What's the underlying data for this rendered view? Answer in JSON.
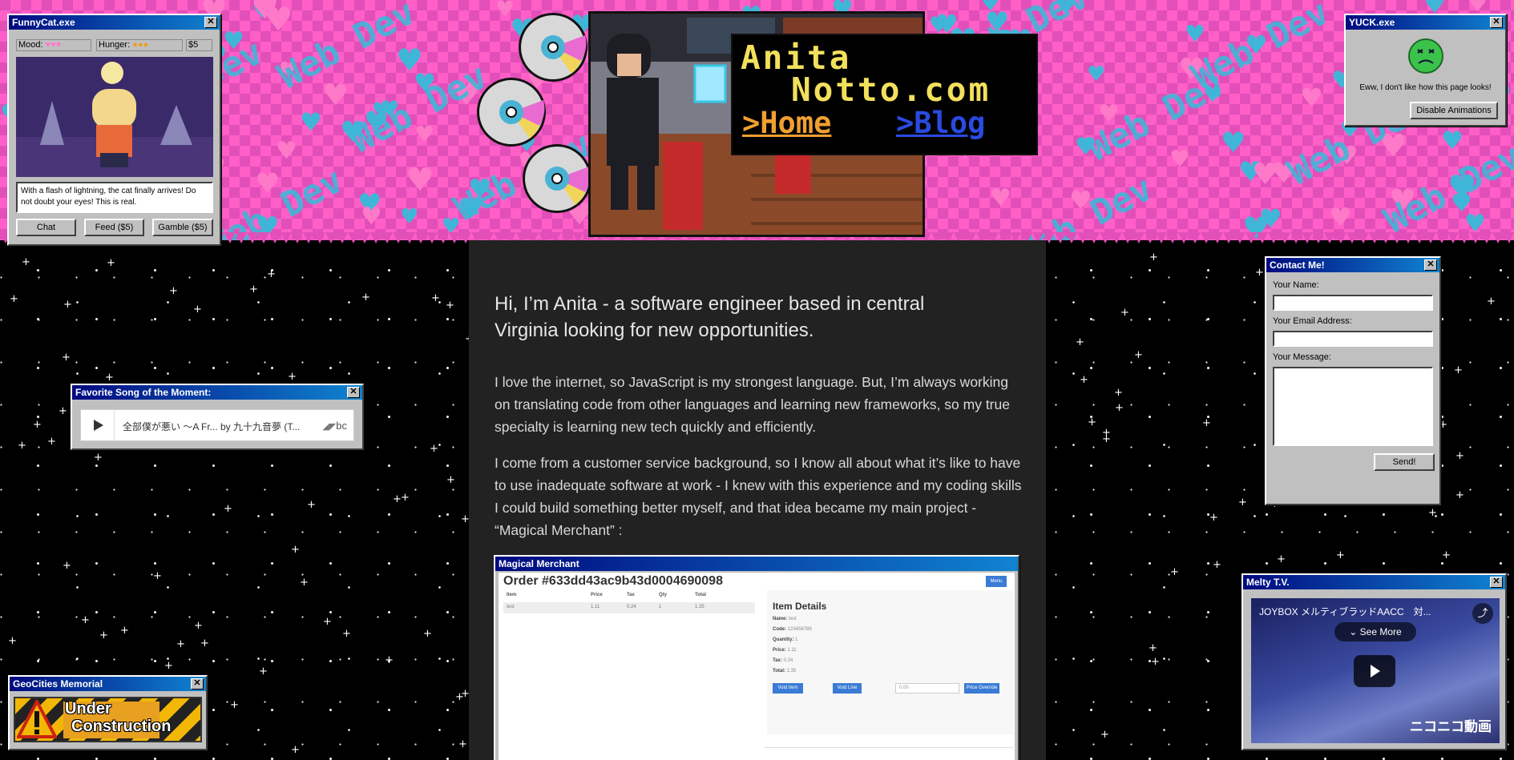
{
  "site": {
    "logo_line1": "Anita",
    "logo_line2": "Notto.com",
    "nav": [
      {
        "label": ">Home"
      },
      {
        "label": ">Blog"
      }
    ],
    "banner_text": "Web Dev"
  },
  "main": {
    "intro": "Hi, I’m Anita - a software engineer based in central Virginia looking for new opportunities.",
    "paragraphs": [
      "I love the internet, so JavaScript is my strongest language. But, I’m always working on translating code from other languages and learning new frameworks, so my true specialty is learning new tech quickly and efficiently.",
      "I come from a customer service background, so I know all about what it’s like to have to use inadequate software at work - I knew with this experience and my coding skills I could build something better myself, and that idea became my main project - “Magical Merchant” :"
    ],
    "project_window": {
      "title": "Magical Merchant",
      "order_title": "Order #633dd43ac9b43d0004690098",
      "menu_button": "Menu",
      "table_headers": [
        "Item",
        "Price",
        "Tax",
        "Qty",
        "Total"
      ],
      "table_row": [
        "test",
        "1.11",
        "0.24",
        "1",
        "1.35"
      ],
      "details_title": "Item Details",
      "details": [
        {
          "label": "Name:",
          "value": "test"
        },
        {
          "label": "Code:",
          "value": "123456789"
        },
        {
          "label": "Quantity:",
          "value": "1"
        },
        {
          "label": "Price:",
          "value": "1.11"
        },
        {
          "label": "Tax:",
          "value": "0.24"
        },
        {
          "label": "Total:",
          "value": "1.35"
        }
      ],
      "buttons": [
        "Void Item",
        "Void Line",
        "Price Override"
      ],
      "price_input": "0.00"
    }
  },
  "funnycat": {
    "title": "FunnyCat.exe",
    "mood_label": "Mood:",
    "mood_icons": "♥♥♥",
    "hunger_label": "Hunger:",
    "hunger_icons": "●●●",
    "money": "$5",
    "message": "With a flash of lightning, the cat finally arrives! Do not doubt your eyes! This is real.",
    "buttons": [
      "Chat",
      "Feed ($5)",
      "Gamble ($5)"
    ]
  },
  "yuck": {
    "title": "YUCK.exe",
    "message": "Eww, I don't like how this page looks!",
    "button": "Disable Animations"
  },
  "song": {
    "title": "Favorite Song of the Moment:",
    "track": "全部僕が悪い 〜A Fr... by 九十九音夢 (T...",
    "service": "bc"
  },
  "contact": {
    "title": "Contact Me!",
    "name_label": "Your Name:",
    "email_label": "Your Email Address:",
    "message_label": "Your Message:",
    "send": "Send!"
  },
  "geocities": {
    "title": "GeoCities Memorial",
    "line1": "Under",
    "line2": "Construction"
  },
  "melty": {
    "title": "Melty T.V.",
    "video_title": "JOYBOX メルティブラッドAACC　対...",
    "see_more": "See More",
    "watermark": "ニコニコ動画"
  },
  "colors": {
    "banner_pink": "#e24fb9",
    "heart_blue": "#3fb6d8",
    "heart_pink": "#ff79c9",
    "logo_yellow": "#f2e05d",
    "home_link": "#f0a030",
    "blog_link": "#2a4ae0",
    "title_bar": "#000a80",
    "window_gray": "#c0c0c0"
  }
}
